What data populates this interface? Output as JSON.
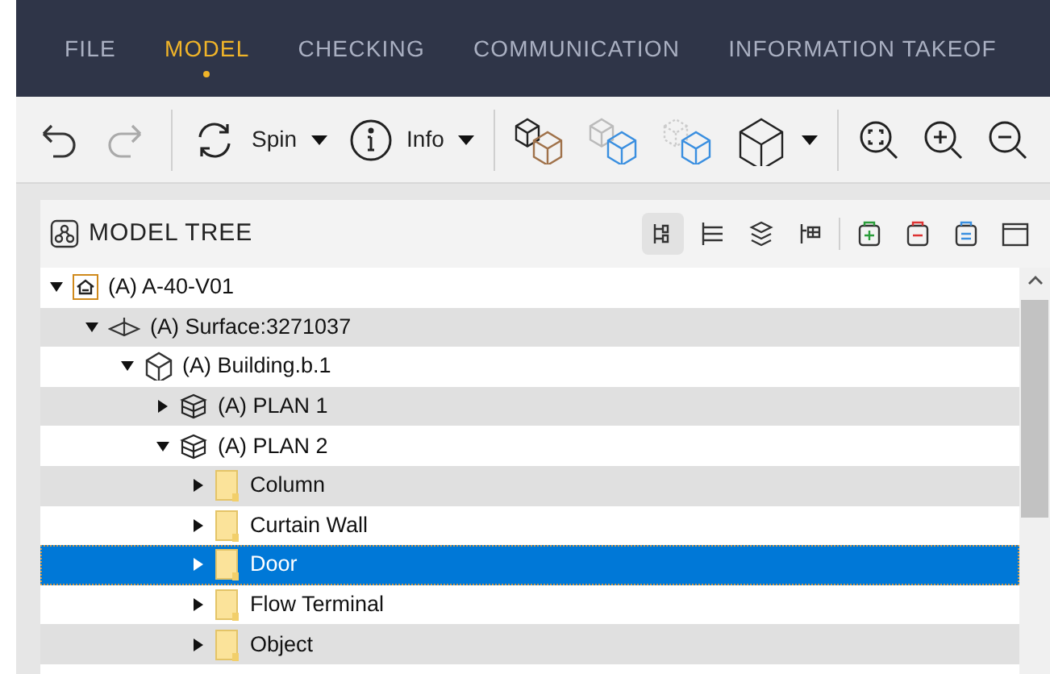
{
  "menu": [
    {
      "label": "FILE",
      "selected": false
    },
    {
      "label": "MODEL",
      "selected": true
    },
    {
      "label": "CHECKING",
      "selected": false
    },
    {
      "label": "COMMUNICATION",
      "selected": false
    },
    {
      "label": "INFORMATION TAKEOF",
      "selected": false
    }
  ],
  "toolbar": [
    {
      "kind": "undo",
      "disabled": false
    },
    {
      "kind": "redo",
      "disabled": true
    },
    {
      "kind": "sep"
    },
    {
      "kind": "spin",
      "label": "Spin"
    },
    {
      "kind": "info",
      "label": "Info"
    },
    {
      "kind": "sep"
    },
    {
      "kind": "cubes"
    },
    {
      "kind": "ghost"
    },
    {
      "kind": "dashed"
    },
    {
      "kind": "cube"
    },
    {
      "kind": "sep"
    },
    {
      "kind": "zoomfit"
    },
    {
      "kind": "zoomin"
    },
    {
      "kind": "zoomout"
    }
  ],
  "panel": {
    "title": "MODEL TREE"
  },
  "tree": [
    {
      "label": "(A) A-40-V01",
      "kind": "project",
      "expanded": true,
      "selected": false,
      "children": [
        {
          "label": "(A) Surface:3271037",
          "kind": "site",
          "expanded": true,
          "selected": false,
          "children": [
            {
              "label": "(A) Building.b.1",
              "kind": "building",
              "expanded": true,
              "selected": false,
              "children": [
                {
                  "label": "(A) PLAN 1",
                  "kind": "storey",
                  "expanded": false,
                  "selected": false
                },
                {
                  "label": "(A) PLAN 2",
                  "kind": "storey",
                  "expanded": true,
                  "selected": false,
                  "children": [
                    {
                      "label": "Column",
                      "kind": "folder",
                      "expanded": false,
                      "selected": false
                    },
                    {
                      "label": "Curtain Wall",
                      "kind": "folder",
                      "expanded": false,
                      "selected": false
                    },
                    {
                      "label": "Door",
                      "kind": "folder",
                      "expanded": false,
                      "selected": true
                    },
                    {
                      "label": "Flow Terminal",
                      "kind": "folder",
                      "expanded": false,
                      "selected": false
                    },
                    {
                      "label": "Object",
                      "kind": "folder",
                      "expanded": false,
                      "selected": false
                    }
                  ]
                }
              ]
            }
          ]
        }
      ]
    }
  ]
}
